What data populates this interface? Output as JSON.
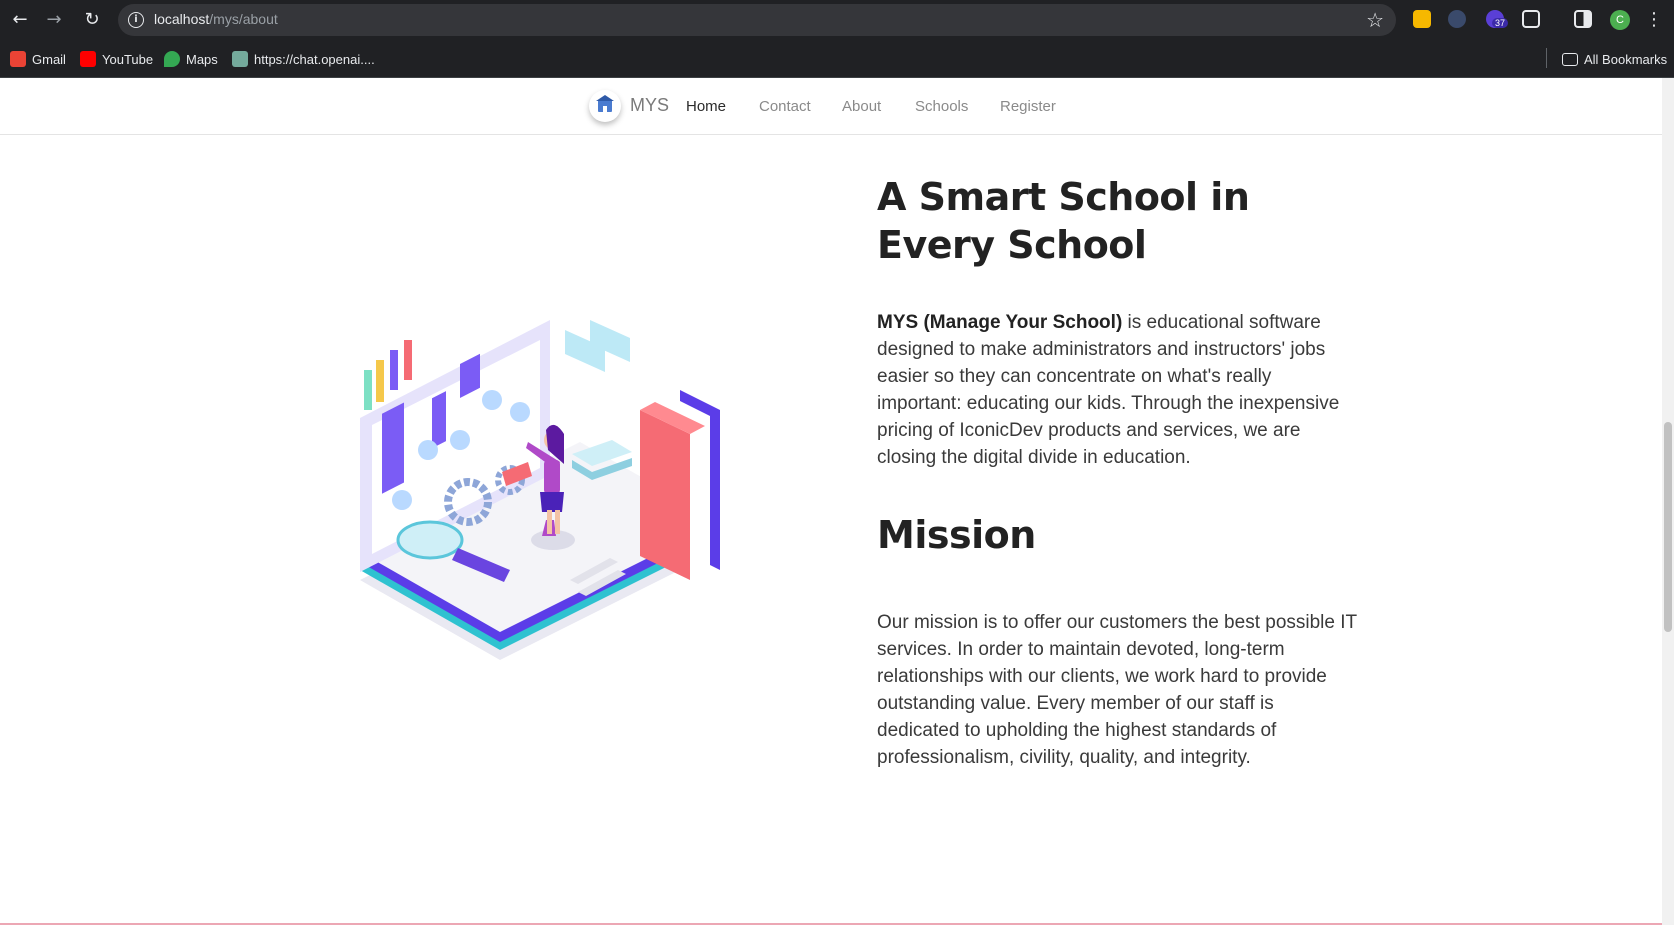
{
  "browser": {
    "url_host": "localhost",
    "url_path": "/mys/about",
    "extension_badge": "37",
    "profile_initial": "C",
    "bookmarks": [
      {
        "label": "Gmail",
        "color": "#ea4335"
      },
      {
        "label": "YouTube",
        "color": "#ff0000"
      },
      {
        "label": "Maps",
        "color": "#34a853"
      },
      {
        "label": "https://chat.openai....",
        "color": "#74aa9c"
      }
    ],
    "all_bookmarks": "All Bookmarks"
  },
  "site": {
    "brand": "MYS",
    "nav": [
      "Home",
      "Contact",
      "About",
      "Schools",
      "Register"
    ],
    "accent": "#6c4cf0"
  },
  "about": {
    "title": "A Smart School in Every School",
    "intro_bold": "MYS (Manage Your School)",
    "intro_rest": " is educational software designed to make administrators and instructors' jobs easier so they can concentrate on what's really important: educating our kids. Through the inexpensive pricing of IconicDev products and services, we are closing the digital divide in education.",
    "mission_title": "Mission",
    "mission_text": "Our mission is to offer our customers the best possible IT services. In order to maintain devoted, long-term relationships with our clients, we work hard to provide outstanding value. Every member of our staff is dedicated to upholding the highest standards of professionalism, civility, quality, and integrity."
  }
}
